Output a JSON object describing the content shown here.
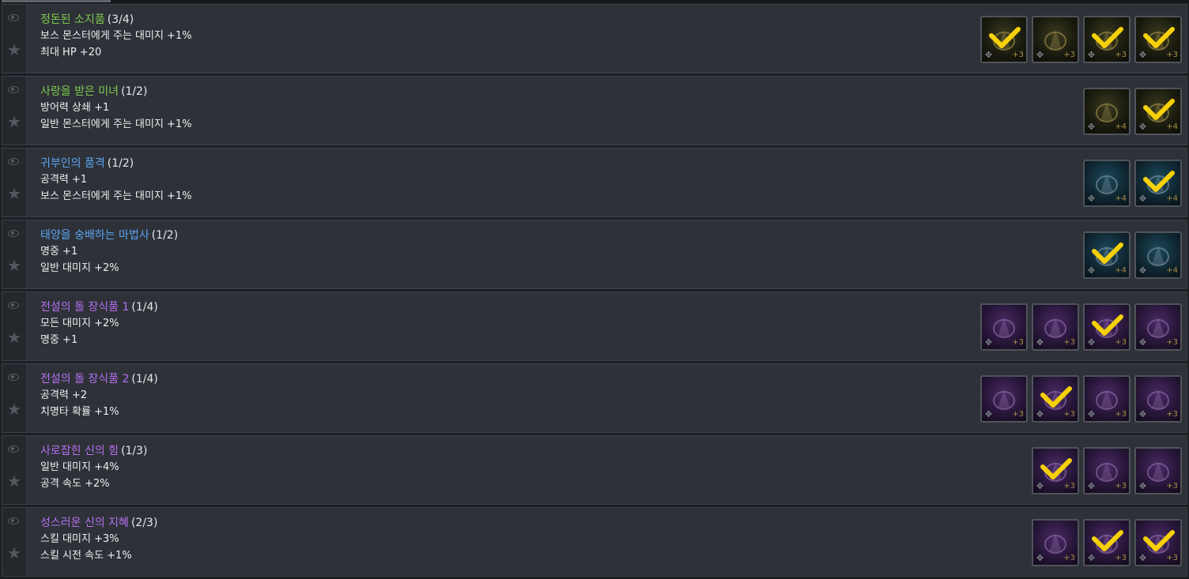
{
  "colors": {
    "green": "#7ec84e",
    "blue": "#5ca3f2",
    "purple": "#b56ef0",
    "check": "#f6d108"
  },
  "sets": [
    {
      "name": "정돈된 소지품",
      "count": "(3/4)",
      "color": "green",
      "effects": [
        "보스 몬스터에게 주는 대미지 +1%",
        "최대 HP +20"
      ],
      "items": [
        {
          "icon": "brush-icon",
          "checked": true,
          "level": "+3"
        },
        {
          "icon": "comb-icon",
          "checked": false,
          "level": "+3"
        },
        {
          "icon": "mirror-icon",
          "checked": true,
          "level": "+3"
        },
        {
          "icon": "hat-icon",
          "checked": true,
          "level": "+3"
        }
      ]
    },
    {
      "name": "사랑을 받은 미녀",
      "count": "(1/2)",
      "color": "green",
      "effects": [
        "방어력 상쇄 +1",
        "일반 몬스터에게 주는 대미지 +1%"
      ],
      "items": [
        {
          "icon": "pendant-icon",
          "checked": false,
          "level": "+4"
        },
        {
          "icon": "portrait-icon",
          "checked": true,
          "level": "+4"
        }
      ]
    },
    {
      "name": "귀부인의 품격",
      "count": "(1/2)",
      "color": "blue",
      "effects": [
        "공격력 +1",
        "보스 몬스터에게 주는 대미지 +1%"
      ],
      "items": [
        {
          "icon": "goblet-icon",
          "checked": false,
          "level": "+4"
        },
        {
          "icon": "brooch-icon",
          "checked": true,
          "level": "+4"
        }
      ]
    },
    {
      "name": "태양을 숭배하는 마법사",
      "count": "(1/2)",
      "color": "blue",
      "effects": [
        "명중 +1",
        "일반 대미지 +2%"
      ],
      "items": [
        {
          "icon": "wizard-hat-icon",
          "checked": true,
          "level": "+4"
        },
        {
          "icon": "bell-icon",
          "checked": false,
          "level": "+4"
        }
      ]
    },
    {
      "name": "전설의 돌 장식품 1",
      "count": "(1/4)",
      "color": "purple",
      "effects": [
        "모든 대미지 +2%",
        "명중 +1"
      ],
      "items": [
        {
          "icon": "chest-icon",
          "checked": false,
          "level": "+3"
        },
        {
          "icon": "claw-icon",
          "checked": false,
          "level": "+3"
        },
        {
          "icon": "relic-icon",
          "checked": true,
          "level": "+3"
        },
        {
          "icon": "skull-icon",
          "checked": false,
          "level": "+3"
        }
      ]
    },
    {
      "name": "전설의 돌 장식품 2",
      "count": "(1/4)",
      "color": "purple",
      "effects": [
        "공격력 +2",
        "치명타 확률 +1%"
      ],
      "items": [
        {
          "icon": "stone-frame-icon",
          "checked": false,
          "level": "+3"
        },
        {
          "icon": "feather-icon",
          "checked": true,
          "level": "+3"
        },
        {
          "icon": "tablet-icon",
          "checked": false,
          "level": "+3"
        },
        {
          "icon": "bird-statue-icon",
          "checked": false,
          "level": "+3"
        }
      ]
    },
    {
      "name": "사로잡힌 신의 힘",
      "count": "(1/3)",
      "color": "purple",
      "effects": [
        "일반 대미지 +4%",
        "공격 속도 +2%"
      ],
      "items": [
        {
          "icon": "orb-shard-icon",
          "checked": true,
          "level": "+3"
        },
        {
          "icon": "gold-ring-icon",
          "checked": false,
          "level": "+3"
        },
        {
          "icon": "dark-orb-icon",
          "checked": false,
          "level": "+3"
        }
      ]
    },
    {
      "name": "성스러운 신의 지혜",
      "count": "(2/3)",
      "color": "purple",
      "effects": [
        "스킬 대미지 +3%",
        "스킬 시전 속도 +1%"
      ],
      "items": [
        {
          "icon": "crown-icon",
          "checked": false,
          "level": "+3"
        },
        {
          "icon": "silver-ring-icon",
          "checked": true,
          "level": "+3"
        },
        {
          "icon": "statuette-icon",
          "checked": true,
          "level": "+3"
        }
      ]
    }
  ]
}
